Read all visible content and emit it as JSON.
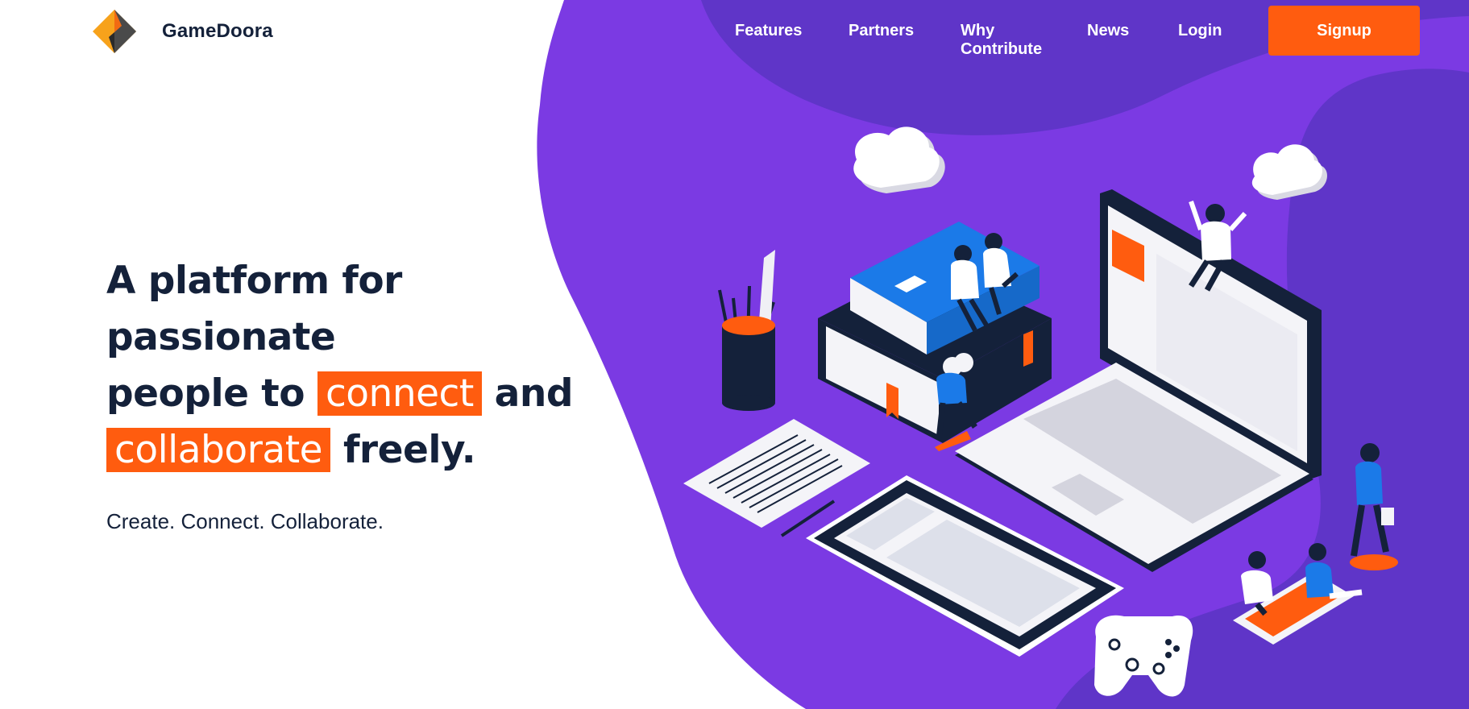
{
  "brand": {
    "name": "GameDoora"
  },
  "nav": {
    "items": [
      {
        "label": "Features"
      },
      {
        "label": "Partners"
      },
      {
        "label": "Why Contribute"
      },
      {
        "label": "News"
      },
      {
        "label": "Login"
      }
    ],
    "signup_label": "Signup"
  },
  "hero": {
    "line1": "A platform for passionate",
    "line2_pre": "people to",
    "line2_highlight": "connect",
    "line2_post": "and",
    "line3_highlight": "collaborate",
    "line3_post": "freely.",
    "tagline": "Create. Connect. Collaborate."
  },
  "colors": {
    "accent": "#ff5c0f",
    "purple": "#7b3ae3",
    "purple_dark": "#5f35c8",
    "navy": "#14213a",
    "blue": "#1b7ae8"
  },
  "illustration": {
    "icons": [
      "cloud-icon",
      "book-stack",
      "laptop",
      "tablet",
      "pencil-cup",
      "document-sheet",
      "gamepad-icon",
      "people"
    ]
  }
}
